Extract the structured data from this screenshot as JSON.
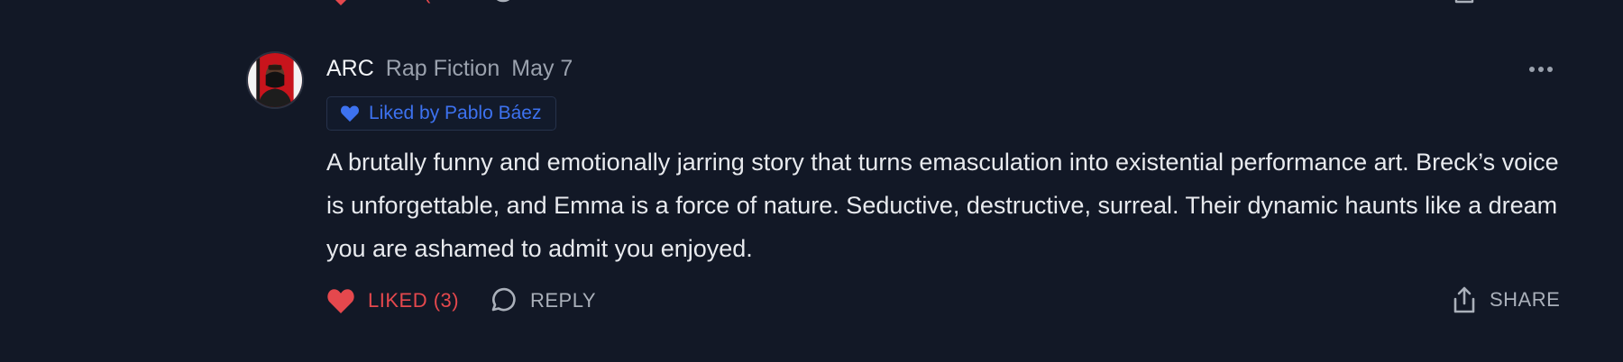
{
  "previous_actions": {
    "liked_fragment": "("
  },
  "comment": {
    "author": "ARC",
    "publication": "Rap Fiction",
    "date": "May 7",
    "liked_by": "Liked by Pablo Báez",
    "body": "A brutally funny and emotionally jarring story that turns emasculation into existential performance art. Breck’s voice is unforgettable, and Emma is a force of nature. Seductive, destructive, surreal. Their dynamic haunts like a dream you are ashamed to admit you enjoyed.",
    "actions": {
      "like_label": "LIKED (3)",
      "reply_label": "REPLY",
      "share_label": "SHARE"
    }
  },
  "icons": {
    "more": "more-horizontal-icon",
    "badge_heart": "heart-filled-icon",
    "like": "heart-filled-icon",
    "reply": "speech-bubble-icon",
    "share": "share-upload-icon"
  },
  "colors": {
    "background": "#121826",
    "liked_red": "#e5484d",
    "badge_blue": "#3d72f0",
    "muted_text": "#9aa1ad",
    "body_text": "#e8eaee"
  }
}
